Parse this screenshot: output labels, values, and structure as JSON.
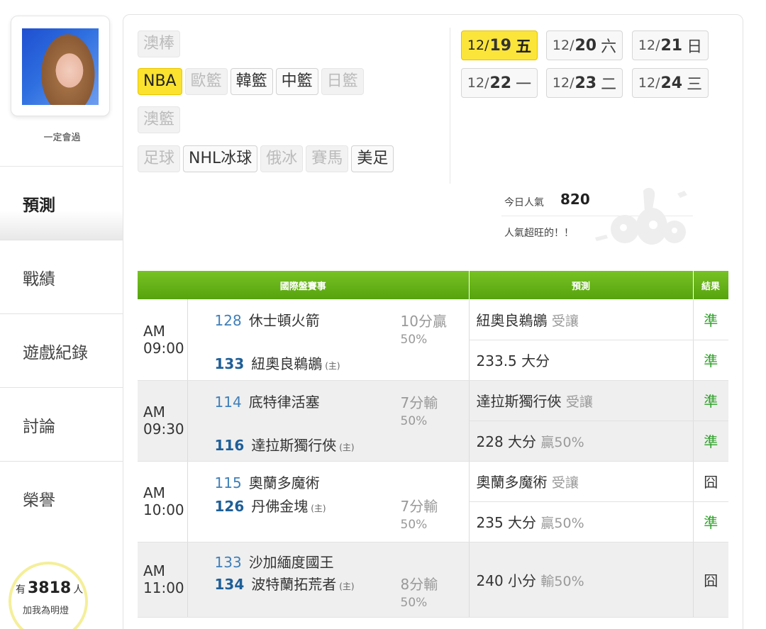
{
  "profile": {
    "username": "一定會過"
  },
  "nav": [
    {
      "label": "預測",
      "active": true
    },
    {
      "label": "戰績",
      "active": false
    },
    {
      "label": "遊戲紀錄",
      "active": false
    },
    {
      "label": "討論",
      "active": false
    },
    {
      "label": "榮譽",
      "active": false
    }
  ],
  "fans": {
    "prefix": "有",
    "count": "3818",
    "suffix": "人",
    "action": "加我為明燈"
  },
  "leagues": {
    "row1": [
      {
        "label": "澳棒",
        "state": "disabled"
      }
    ],
    "row2": [
      {
        "label": "NBA",
        "state": "active"
      },
      {
        "label": "歐籃",
        "state": "disabled"
      },
      {
        "label": "韓籃",
        "state": "normal"
      },
      {
        "label": "中籃",
        "state": "normal"
      },
      {
        "label": "日籃",
        "state": "disabled"
      }
    ],
    "row3": [
      {
        "label": "澳籃",
        "state": "disabled"
      }
    ],
    "row4": [
      {
        "label": "足球",
        "state": "disabled"
      },
      {
        "label": "NHL冰球",
        "state": "normal"
      },
      {
        "label": "俄冰",
        "state": "disabled"
      },
      {
        "label": "賽馬",
        "state": "disabled"
      },
      {
        "label": "美足",
        "state": "normal"
      }
    ]
  },
  "dates": [
    {
      "month": "12/",
      "day": "19",
      "weekday": "五",
      "active": true
    },
    {
      "month": "12/",
      "day": "20",
      "weekday": "六",
      "active": false
    },
    {
      "month": "12/",
      "day": "21",
      "weekday": "日",
      "active": false
    },
    {
      "month": "12/",
      "day": "22",
      "weekday": "一",
      "active": false
    },
    {
      "month": "12/",
      "day": "23",
      "weekday": "二",
      "active": false
    },
    {
      "month": "12/",
      "day": "24",
      "weekday": "三",
      "active": false
    }
  ],
  "popularity": {
    "label": "今日人氣",
    "value": "820",
    "note": "人氣超旺的！！"
  },
  "table": {
    "headers": {
      "match": "國際盤賽事",
      "prediction": "預測",
      "result": "結果"
    },
    "games": [
      {
        "time": "AM 09:00",
        "away_no": "128",
        "away": "休士頓火箭",
        "home_no": "133",
        "home": "紐奧良鵜鶘",
        "host_tag": "(主)",
        "line": "10分贏",
        "line_pct": "50%",
        "preds": [
          {
            "text": "紐奧良鵜鶘",
            "sub": "受讓",
            "result": "準"
          },
          {
            "text": "233.5 大分",
            "sub": "",
            "result": "準"
          }
        ]
      },
      {
        "time": "AM 09:30",
        "away_no": "114",
        "away": "底特律活塞",
        "home_no": "116",
        "home": "達拉斯獨行俠",
        "host_tag": "(主)",
        "line": "7分輸",
        "line_pct": "50%",
        "preds": [
          {
            "text": "達拉斯獨行俠",
            "sub": "受讓",
            "result": "準"
          },
          {
            "text": "228 大分",
            "sub": "贏50%",
            "result": "準"
          }
        ]
      },
      {
        "time": "AM 10:00",
        "away_no": "115",
        "away": "奧蘭多魔術",
        "home_no": "126",
        "home": "丹佛金塊",
        "host_tag": "(主)",
        "line": "7分輸",
        "line_pct": "50%",
        "preds": [
          {
            "text": "奧蘭多魔術",
            "sub": "受讓",
            "result": "囧"
          },
          {
            "text": "235 大分",
            "sub": "贏50%",
            "result": "準"
          }
        ]
      },
      {
        "time": "AM 11:00",
        "away_no": "133",
        "away": "沙加緬度國王",
        "home_no": "134",
        "home": "波特蘭拓荒者",
        "host_tag": "(主)",
        "line": "8分輸",
        "line_pct": "50%",
        "preds": [
          {
            "text": "240 小分",
            "sub": "輸50%",
            "result": "囧"
          }
        ]
      }
    ]
  },
  "colors": {
    "accent_yellow": "#fce53a",
    "header_green": "#6bb51c",
    "win_green": "#2fa22a"
  }
}
